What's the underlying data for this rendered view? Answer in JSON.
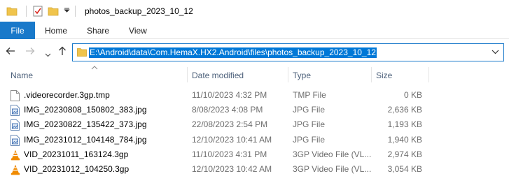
{
  "window": {
    "title": "photos_backup_2023_10_12"
  },
  "ribbon": {
    "tabs": [
      {
        "label": "File"
      },
      {
        "label": "Home"
      },
      {
        "label": "Share"
      },
      {
        "label": "View"
      }
    ]
  },
  "address": {
    "path": "E:\\Android\\data\\Com.HemaX.HX2.Android\\files\\photos_backup_2023_10_12"
  },
  "columns": {
    "name": "Name",
    "date": "Date modified",
    "type": "Type",
    "size": "Size"
  },
  "files": [
    {
      "name": ".videorecorder.3gp.tmp",
      "date": "11/10/2023 4:32 PM",
      "type": "TMP File",
      "size": "0 KB",
      "icon": "blank-file-icon"
    },
    {
      "name": "IMG_20230808_150802_383.jpg",
      "date": "8/08/2023 4:08 PM",
      "type": "JPG File",
      "size": "2,636 KB",
      "icon": "image-file-icon"
    },
    {
      "name": "IMG_20230822_135422_373.jpg",
      "date": "22/08/2023 2:54 PM",
      "type": "JPG File",
      "size": "1,193 KB",
      "icon": "image-file-icon"
    },
    {
      "name": "IMG_20231012_104148_784.jpg",
      "date": "12/10/2023 10:41 AM",
      "type": "JPG File",
      "size": "1,940 KB",
      "icon": "image-file-icon"
    },
    {
      "name": "VID_20231011_163124.3gp",
      "date": "11/10/2023 4:31 PM",
      "type": "3GP Video File (VL...",
      "size": "2,974 KB",
      "icon": "vlc-cone-icon"
    },
    {
      "name": "VID_20231012_104250.3gp",
      "date": "12/10/2023 10:42 AM",
      "type": "3GP Video File (VL...",
      "size": "3,054 KB",
      "icon": "vlc-cone-icon"
    }
  ],
  "colors": {
    "accent": "#1979ca",
    "selection": "#0078d7",
    "folder": "#f0c44c",
    "vlc": "#f08a00"
  }
}
